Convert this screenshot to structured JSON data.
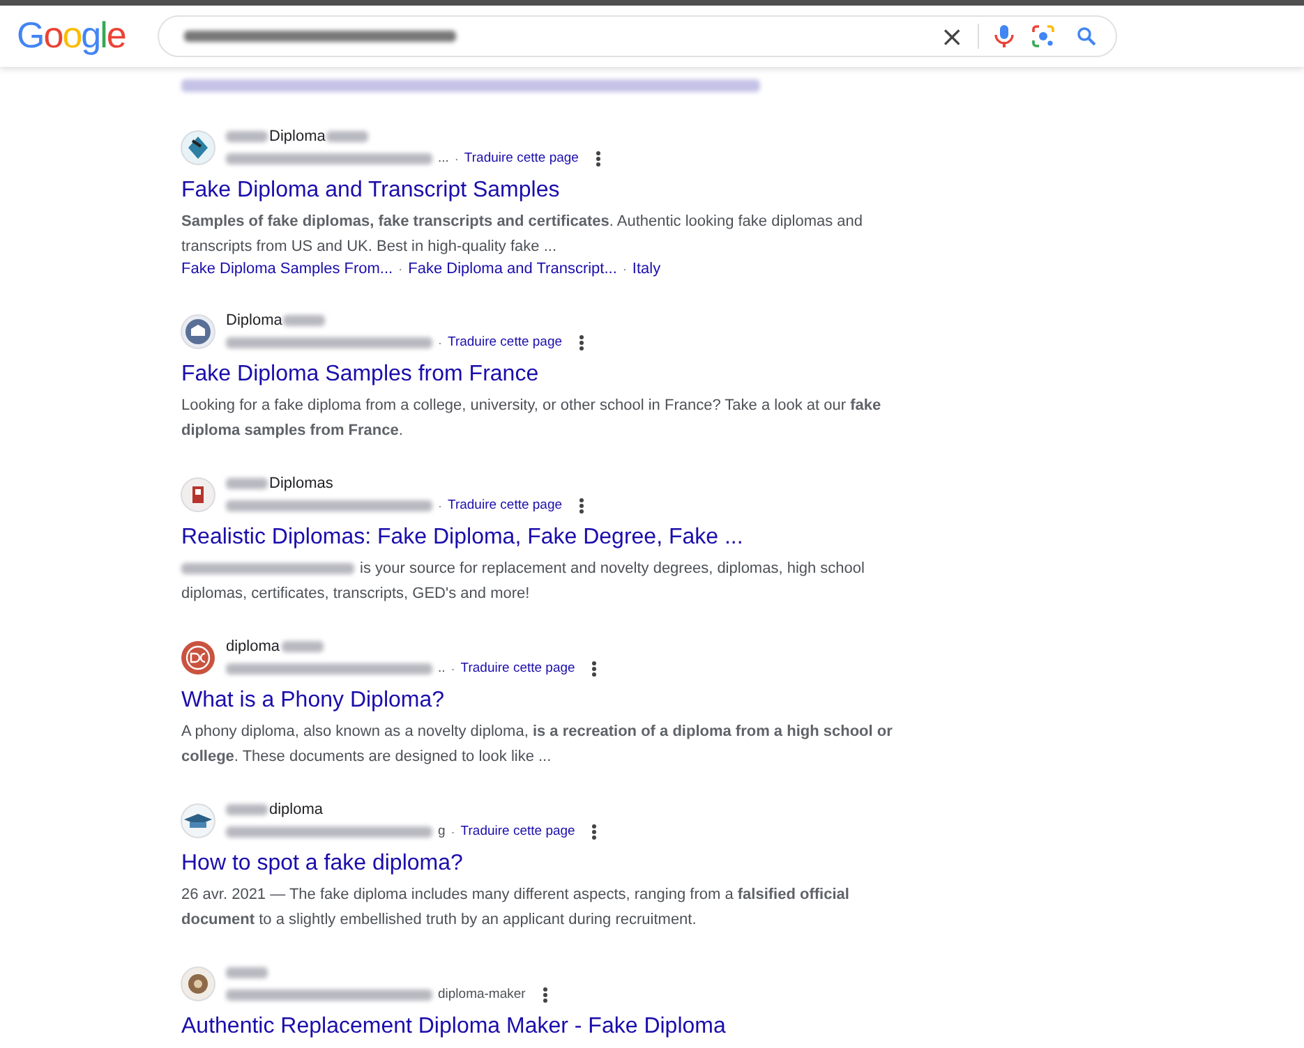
{
  "logo": "Google",
  "search": {
    "query_redacted": true,
    "buttons": [
      "×"
    ]
  },
  "related_redacted": true,
  "results": [
    {
      "site": [
        {
          "kind": "blur"
        },
        {
          "kind": "text",
          "text": "Diploma"
        },
        {
          "kind": "blur"
        }
      ],
      "url": [
        {
          "kind": "blur"
        },
        {
          "kind": "text",
          "text": "..."
        },
        {
          "kind": "sep",
          "text": "·"
        },
        {
          "kind": "link",
          "text": "Traduire cette page"
        }
      ],
      "title": "Fake Diploma and Transcript Samples",
      "snippet": [
        {
          "kind": "text",
          "text": "**Samples of fake diplomas, fake transcripts and certificates**. Authentic looking fake diplomas and transcripts from US and UK. Best in high-quality fake ..."
        }
      ],
      "sitelinks": [
        {
          "kind": "link",
          "text": "Fake Diploma Samples From..."
        },
        {
          "kind": "sep",
          "text": "·"
        },
        {
          "kind": "link",
          "text": "Fake Diploma and Transcript..."
        },
        {
          "kind": "sep",
          "text": "·"
        },
        {
          "kind": "link",
          "text": "Italy"
        }
      ]
    },
    {
      "site": [
        {
          "kind": "text",
          "text": "Diploma"
        },
        {
          "kind": "blur"
        }
      ],
      "url": [
        {
          "kind": "blur"
        },
        {
          "kind": "sep",
          "text": "·"
        },
        {
          "kind": "link",
          "text": "Traduire cette page"
        }
      ],
      "title": "Fake Diploma Samples from France",
      "snippet": [
        {
          "kind": "text",
          "text": "Looking for a fake diploma from a college, university, or other school in France? Take a look at our **fake diploma samples from France**."
        }
      ]
    },
    {
      "site": [
        {
          "kind": "blur"
        },
        {
          "kind": "text",
          "text": "Diplomas"
        }
      ],
      "url": [
        {
          "kind": "blur"
        },
        {
          "kind": "sep",
          "text": "·"
        },
        {
          "kind": "link",
          "text": "Traduire cette page"
        }
      ],
      "title": "Realistic Diplomas: Fake Diploma, Fake Degree, Fake ...",
      "snippet": [
        {
          "kind": "blur"
        },
        {
          "kind": "text",
          "text": "is your source for replacement and novelty degrees, diplomas, high school"
        },
        {
          "kind": "break"
        },
        {
          "kind": "text",
          "text": "diplomas, certificates, transcripts, GED's and more!"
        }
      ]
    },
    {
      "site": [
        {
          "kind": "text",
          "text": "diploma"
        },
        {
          "kind": "blur"
        }
      ],
      "url": [
        {
          "kind": "blur"
        },
        {
          "kind": "text",
          "text": ".."
        },
        {
          "kind": "sep",
          "text": "·"
        },
        {
          "kind": "link",
          "text": "Traduire cette page"
        }
      ],
      "title": "What is a Phony Diploma?",
      "snippet": [
        {
          "kind": "text",
          "text": "A phony diploma, also known as a novelty diploma, **is a recreation of a diploma from a high school or college**. These documents are designed to look like ..."
        }
      ]
    },
    {
      "site": [
        {
          "kind": "blur"
        },
        {
          "kind": "text",
          "text": "diploma"
        }
      ],
      "url": [
        {
          "kind": "blur"
        },
        {
          "kind": "text",
          "text": "g"
        },
        {
          "kind": "sep",
          "text": "·"
        },
        {
          "kind": "link",
          "text": "Traduire cette page"
        }
      ],
      "title": "How to spot a fake diploma?",
      "snippet": [
        {
          "kind": "text",
          "text": "26 avr. 2021 — The fake diploma includes many different aspects, ranging from a **falsified official document** to a slightly embellished truth by an applicant during recruitment."
        }
      ]
    },
    {
      "site": [
        {
          "kind": "blur"
        }
      ],
      "url": [
        {
          "kind": "blur"
        },
        {
          "kind": "text",
          "text": "diploma-maker"
        }
      ],
      "title": "Authentic Replacement Diploma Maker - Fake Diploma"
    }
  ]
}
